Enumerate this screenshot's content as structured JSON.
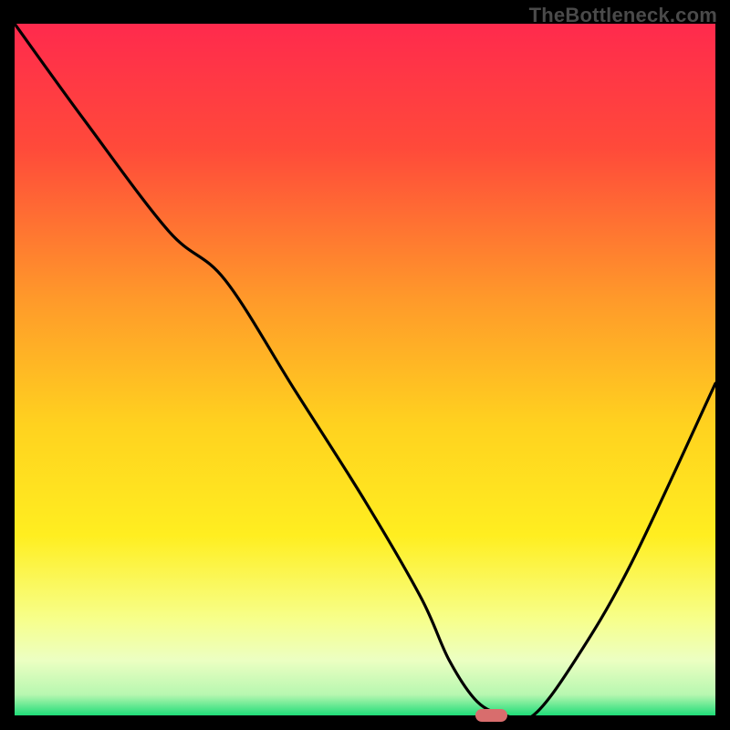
{
  "watermark": "TheBottleneck.com",
  "colors": {
    "frame": "#000000",
    "curve": "#000000",
    "marker": "#d86d6d",
    "gradient_stops": [
      {
        "offset": 0.0,
        "color": "#ff2a4d"
      },
      {
        "offset": 0.18,
        "color": "#ff4a3a"
      },
      {
        "offset": 0.4,
        "color": "#ff9a2a"
      },
      {
        "offset": 0.58,
        "color": "#ffd21f"
      },
      {
        "offset": 0.74,
        "color": "#ffee20"
      },
      {
        "offset": 0.86,
        "color": "#f7ff8a"
      },
      {
        "offset": 0.92,
        "color": "#ecffc2"
      },
      {
        "offset": 0.97,
        "color": "#b7f7b0"
      },
      {
        "offset": 1.0,
        "color": "#1fdc78"
      }
    ]
  },
  "chart_data": {
    "type": "line",
    "title": "",
    "xlabel": "",
    "ylabel": "",
    "xlim": [
      0,
      100
    ],
    "ylim": [
      0,
      100
    ],
    "grid": false,
    "legend": false,
    "series": [
      {
        "name": "bottleneck-curve",
        "x": [
          0,
          10,
          22,
          30,
          40,
          50,
          58,
          62,
          66,
          70,
          74,
          80,
          88,
          100
        ],
        "y": [
          100,
          86,
          70,
          63,
          47,
          31,
          17,
          8,
          2,
          0,
          0,
          8,
          22,
          48
        ]
      }
    ],
    "marker": {
      "x": 68,
      "y": 0,
      "width_pct": 4.5,
      "height_pct": 1.8
    },
    "annotations": []
  }
}
